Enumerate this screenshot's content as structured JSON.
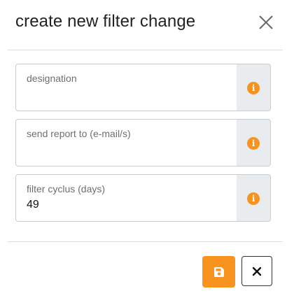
{
  "modal": {
    "title": "create new filter change",
    "close_icon": "close-icon"
  },
  "form": {
    "fields": [
      {
        "label": "designation",
        "value": "",
        "addon_icon": "info-icon",
        "addon_glyph": "i"
      },
      {
        "label": "send report to (e-mail/s)",
        "value": "",
        "addon_icon": "info-icon",
        "addon_glyph": "i"
      },
      {
        "label": "filter cyclus (days)",
        "value": "49",
        "addon_icon": "info-icon",
        "addon_glyph": "i"
      }
    ]
  },
  "footer": {
    "save_icon": "floppy-disk-icon",
    "cancel_icon": "close-icon"
  },
  "colors": {
    "accent": "#f7931e",
    "addon_bg": "#e9ecef",
    "border": "#c9ccd0"
  }
}
